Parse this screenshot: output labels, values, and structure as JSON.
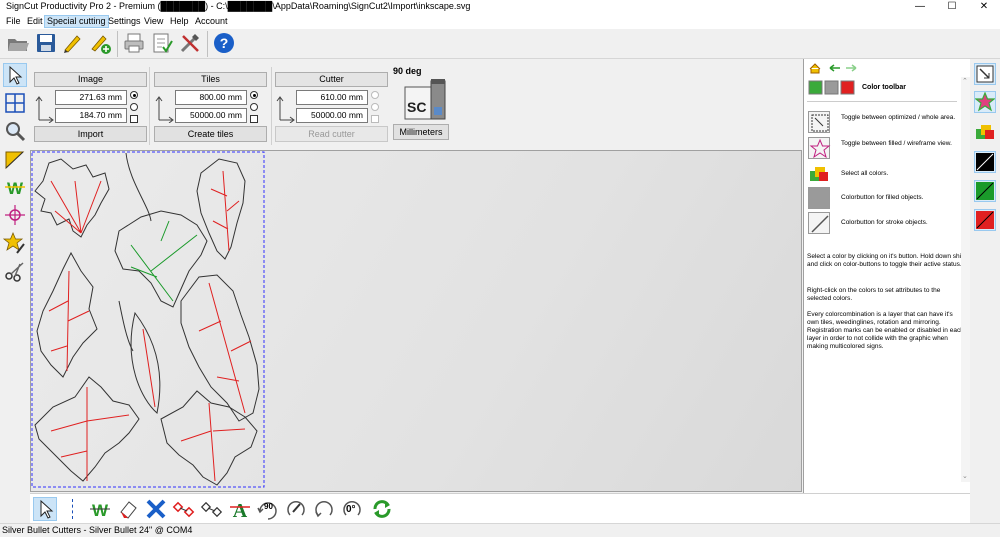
{
  "window": {
    "title": "SignCut Productivity Pro 2 - Premium (███████) - C:\\███████\\AppData\\Roaming\\SignCut2\\Import\\inkscape.svg",
    "minimize": "—",
    "maximize": "☐",
    "close": "✕"
  },
  "menu": {
    "items": [
      "File",
      "Edit",
      "Special cutting",
      "Settings",
      "View",
      "Help",
      "Account"
    ],
    "active": "Special cutting"
  },
  "toolbar": {
    "icons": [
      "open-folder-icon",
      "save-icon",
      "edit-pen-icon",
      "edit-add-icon",
      "print-icon",
      "checklist-icon",
      "tools-icon",
      "help-icon"
    ]
  },
  "left_tools": {
    "icons": [
      "select-arrow-icon",
      "tiles-grid-icon",
      "zoom-icon",
      "weed-triangle-icon",
      "weedline-w-icon",
      "registration-mark-icon",
      "star-edit-icon",
      "scissors-icon"
    ]
  },
  "image_panel": {
    "header": "Image",
    "width_value": "271.63 mm",
    "height_value": "184.70 mm",
    "button": "Import"
  },
  "tiles_panel": {
    "header": "Tiles",
    "width_value": "800.00 mm",
    "height_value": "50000.00 mm",
    "button": "Create tiles"
  },
  "cutter_panel": {
    "header": "Cutter",
    "width_value": "610.00 mm",
    "height_value": "50000.00 mm",
    "button": "Read cutter"
  },
  "rotation": {
    "label": "90 deg",
    "badge": "SC",
    "units_button": "Millimeters"
  },
  "right_panel": {
    "nav_icons": [
      "home-icon",
      "back-arrow-icon",
      "forward-arrow-icon"
    ],
    "title": "Color toolbar",
    "help_items": [
      {
        "icon": "optimize-toggle-icon",
        "text": "Toggle between optimized / whole area."
      },
      {
        "icon": "wireframe-toggle-icon",
        "text": "Toggle between filled / wireframe view."
      },
      {
        "icon": "select-colors-icon",
        "text": "Select all colors."
      },
      {
        "icon": "fill-color-icon",
        "text": "Colorbutton for filled objects."
      },
      {
        "icon": "stroke-color-icon",
        "text": "Colorbutton for stroke objects."
      }
    ],
    "paragraphs": [
      "Select a color by clicking on it's button. Hold down shift and click on color-buttons to toggle their active status.",
      "Right-click on the colors to set attributes to the selected colors.",
      "Every colorcombination is a layer that can have it's own tiles, weedinglines, rotation and mirroring. Registration marks can be enabled or disabled in each layer in order to not collide with the graphic when making multicolored signs."
    ]
  },
  "right_strip": {
    "buttons": [
      "wireframe-icon",
      "star-color-icon",
      "all-colors-icon",
      "black-stroke-icon",
      "green-stroke-icon",
      "red-stroke-icon"
    ],
    "colors": [
      "#000000",
      "#000000",
      "#000000",
      "#000000",
      "#1a9a2a",
      "#e02020"
    ]
  },
  "bottom_toolbar": {
    "icons": [
      "select-arrow-icon",
      "weedline-icon",
      "eraser-icon",
      "delete-x-icon",
      "nodes-red-icon",
      "nodes-icon",
      "text-a-icon",
      "rotate-90-icon",
      "rotate-cw-icon",
      "rotate-free-icon",
      "rotate-zero-icon",
      "refresh-icon"
    ],
    "rotate_label": "90",
    "zero_label": "0°"
  },
  "status": {
    "text": "Silver Bullet Cutters - Silver Bullet 24\" @ COM4"
  },
  "colors": {
    "accent": "#cce4f7",
    "leaf_outline": "#333333",
    "leaf_red": "#e02020",
    "leaf_green": "#1a9a2a",
    "selection": "#3030ff"
  }
}
